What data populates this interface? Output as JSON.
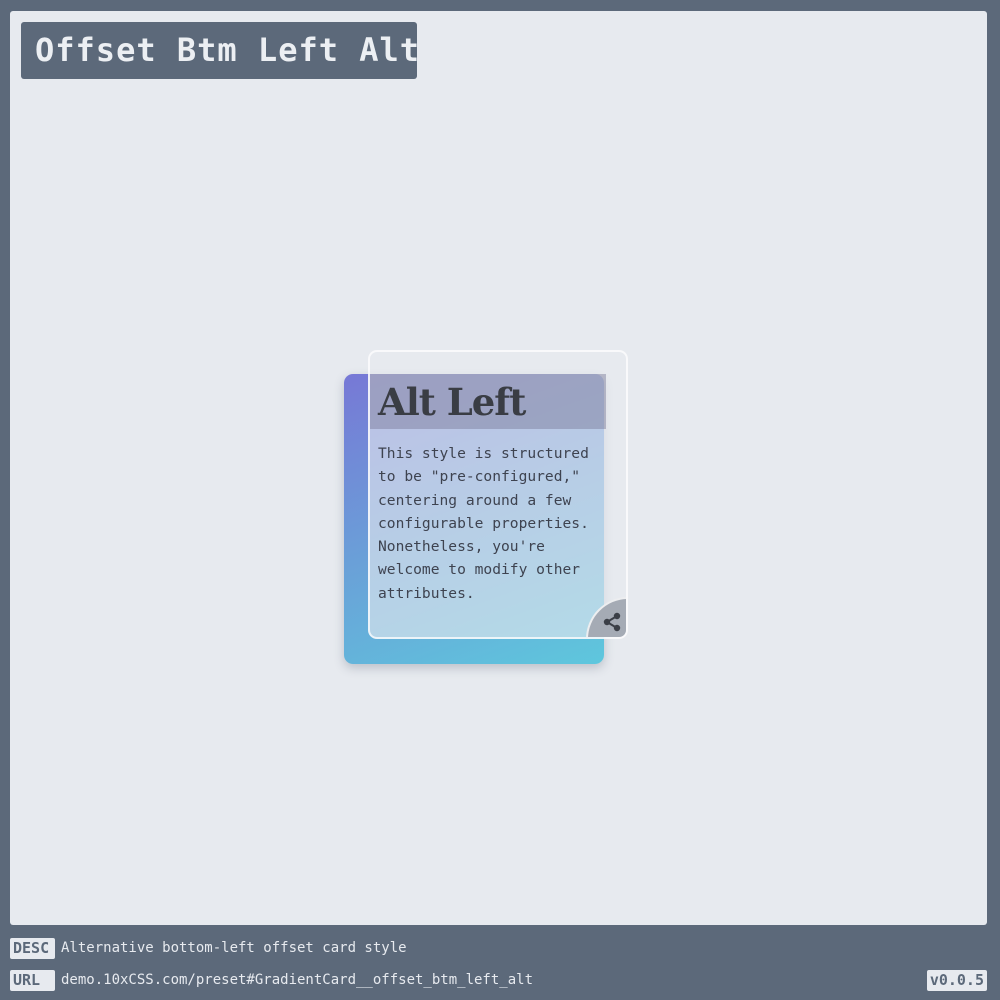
{
  "page": {
    "title": "Offset Btm Left Alt"
  },
  "card": {
    "title": "Alt Left",
    "body": "This style is structured to be \"pre-configured,\" centering around a few configurable properties. Nonetheless, you're welcome to modify other attributes.",
    "share_icon": "share-icon",
    "gradient_colors": [
      "#7778d6",
      "#6aa0d8",
      "#5ec7dd"
    ]
  },
  "footer": {
    "desc_label": "DESC",
    "desc_text": "Alternative bottom-left offset card style",
    "url_label": "URL",
    "url_text": "demo.10xCSS.com/preset#GradientCard__offset_btm_left_alt",
    "version": "v0.0.5"
  },
  "colors": {
    "frame": "#5c697a",
    "stage": "#e7eaef"
  }
}
